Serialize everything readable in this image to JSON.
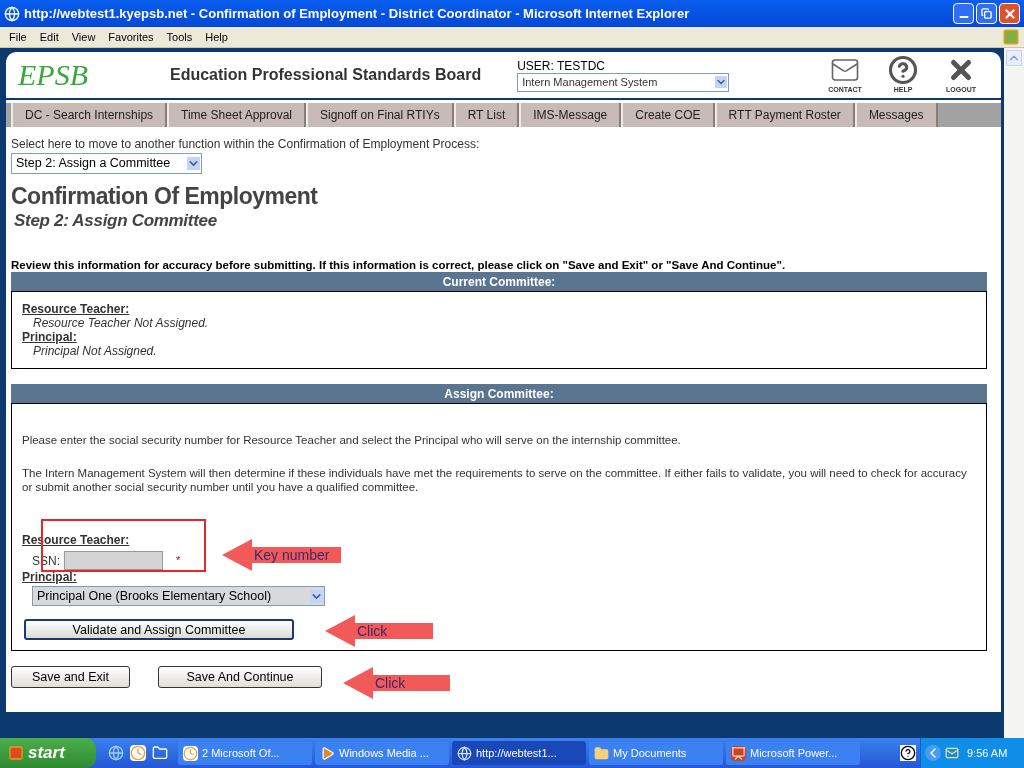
{
  "window": {
    "title": "http://webtest1.kyepsb.net - Confirmation of Employment - District Coordinator - Microsoft Internet Explorer"
  },
  "menu": [
    "File",
    "Edit",
    "View",
    "Favorites",
    "Tools",
    "Help"
  ],
  "header": {
    "logo": "EPSB",
    "org": "Education Professional Standards Board",
    "user": "USER: TESTDC",
    "system_select": "Intern Management System",
    "icons": [
      {
        "kind": "mail",
        "label": "CONTACT"
      },
      {
        "kind": "help",
        "label": "HELP"
      },
      {
        "kind": "logout",
        "label": "LOGOUT"
      }
    ]
  },
  "nav_tabs": [
    "DC - Search Internships",
    "Time Sheet Approval",
    "Signoff on Final RTIYs",
    "RT List",
    "IMS-Message",
    "Create COE",
    "RTT Payment Roster",
    "Messages"
  ],
  "process": {
    "prompt": "Select here to move to another function within the Confirmation of Employment Process:",
    "step_select": "Step 2: Assign a Committee"
  },
  "title": "Confirmation Of Employment",
  "subtitle": "Step 2: Assign Committee",
  "review_note": "Review this information for accuracy before submitting. If this information is correct, please click on \"Save and Exit\" or \"Save And Continue\".",
  "current_committee": {
    "heading": "Current Committee:",
    "entries": [
      {
        "label": "Resource Teacher:",
        "value": "Resource Teacher Not Assigned."
      },
      {
        "label": "Principal:",
        "value": "Principal Not Assigned."
      }
    ]
  },
  "assign_committee": {
    "heading": "Assign Committee:",
    "paragraphs": [
      "Please enter the social security number for Resource Teacher and select the Principal who will serve on the internship committee.",
      "The Intern Management System will then determine if these individuals have met the requirements to serve on the committee. If either fails to validate, you will need to check for accuracy or submit another social security number until you have a qualified committee."
    ],
    "resource_label": "Resource Teacher:",
    "ssn_label": "SSN:",
    "required_mark": "*",
    "principal_label": "Principal:",
    "principal_select": "Principal One (Brooks Elementary School)",
    "validate_button": "Validate and Assign Committee"
  },
  "buttons": [
    "Save and Exit",
    "Save And Continue"
  ],
  "annotations": [
    "Key number",
    "Click",
    "Click"
  ],
  "taskbar": {
    "start": "start",
    "tasks": [
      {
        "kind": "clock",
        "label": "2 Microsoft Of...",
        "selected": false
      },
      {
        "kind": "media",
        "label": "Windows Media ...",
        "selected": false
      },
      {
        "kind": "browser",
        "label": "http://webtest1...",
        "selected": true
      },
      {
        "kind": "folder",
        "label": "My Documents",
        "selected": false
      },
      {
        "kind": "slides",
        "label": "Microsoft Power...",
        "selected": false
      }
    ],
    "clock": "9:56 AM"
  }
}
